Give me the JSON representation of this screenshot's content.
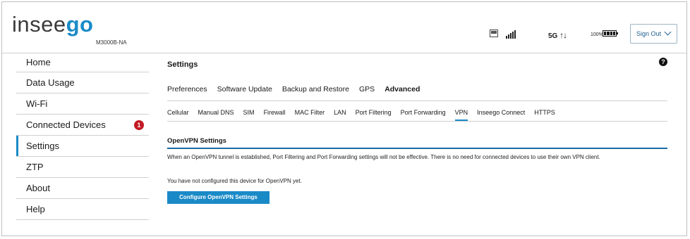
{
  "header": {
    "brand_part1": "insee",
    "brand_part2": "go",
    "model": "M3000B-NA",
    "network": "5G",
    "network_arrows": "↑↓",
    "battery_percent": "100%",
    "sign_out_label": "Sign Out"
  },
  "icons": [
    "document-icon",
    "signal-icon",
    "battery-icon",
    "chevron-down-icon",
    "help-icon"
  ],
  "sidebar": {
    "items": [
      {
        "label": "Home"
      },
      {
        "label": "Data Usage"
      },
      {
        "label": "Wi-Fi"
      },
      {
        "label": "Connected Devices",
        "badge": "1"
      },
      {
        "label": "Settings"
      },
      {
        "label": "ZTP"
      },
      {
        "label": "About"
      },
      {
        "label": "Help"
      }
    ]
  },
  "main": {
    "title": "Settings",
    "help_glyph": "?",
    "tabs": [
      {
        "label": "Preferences"
      },
      {
        "label": "Software Update"
      },
      {
        "label": "Backup and Restore"
      },
      {
        "label": "GPS"
      },
      {
        "label": "Advanced"
      }
    ],
    "subtabs": [
      {
        "label": "Cellular"
      },
      {
        "label": "Manual DNS"
      },
      {
        "label": "SIM"
      },
      {
        "label": "Firewall"
      },
      {
        "label": "MAC Filter"
      },
      {
        "label": "LAN"
      },
      {
        "label": "Port Filtering"
      },
      {
        "label": "Port Forwarding"
      },
      {
        "label": "VPN"
      },
      {
        "label": "Inseego Connect"
      },
      {
        "label": "HTTPS"
      }
    ],
    "section_title": "OpenVPN Settings",
    "info_text": "When an OpenVPN tunnel is established, Port Filtering and Port Forwarding settings will not be effective. There is no need for connected devices to use their own VPN client.",
    "not_configured_text": "You have not configured this device for OpenVPN yet.",
    "configure_button": "Configure OpenVPN Settings"
  },
  "colors": {
    "accent": "#1a8ac7",
    "badge": "#c41a24",
    "section_line": "#1a6aa5"
  }
}
